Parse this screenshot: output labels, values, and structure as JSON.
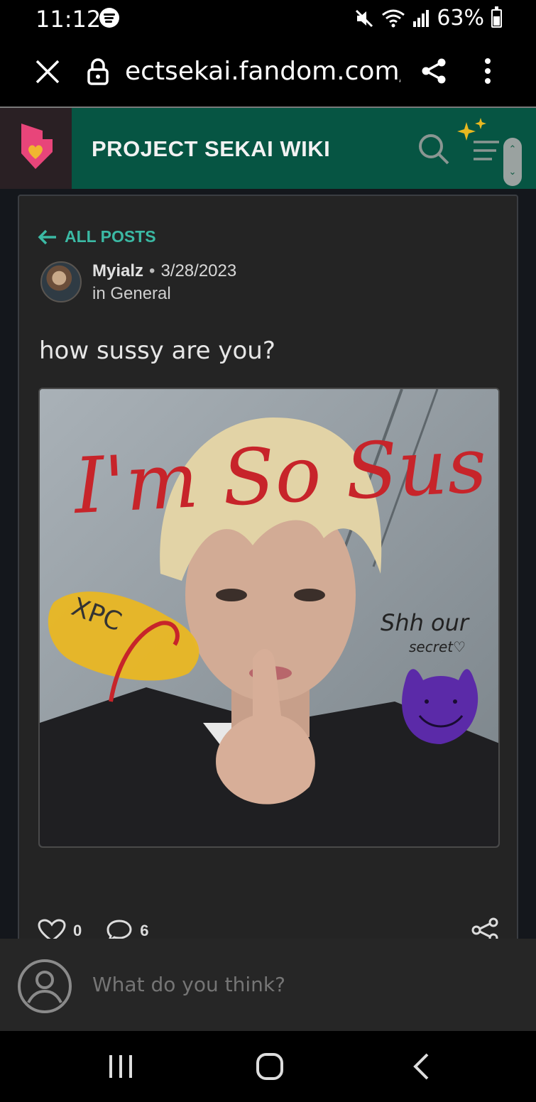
{
  "status_bar": {
    "time": "11:12",
    "battery": "63%",
    "battery_level": 0.63
  },
  "browser": {
    "url": "ectsekai.fandom.com/f",
    "icons": [
      "close-icon",
      "lock-icon",
      "share-icon",
      "more-vertical-icon"
    ]
  },
  "wiki": {
    "title": "PROJECT SEKAI WIKI",
    "colors": {
      "header_bg": "#065543",
      "accent": "#3bb9a4",
      "fandom_pink": "#e8457a"
    }
  },
  "post": {
    "back_label": "ALL POSTS",
    "author": "Myialz",
    "date": "3/28/2023",
    "category": "in General",
    "title": "how sussy are you?",
    "image_text": {
      "headline": "I'm So Sus",
      "note": "Shh our",
      "note2": "secret♡",
      "tag": "XPC"
    },
    "likes": "0",
    "comments": "6"
  },
  "comment_bar": {
    "placeholder": "What do you think?"
  },
  "nav": {
    "icons": [
      "recents-icon",
      "home-icon",
      "back-icon"
    ]
  }
}
